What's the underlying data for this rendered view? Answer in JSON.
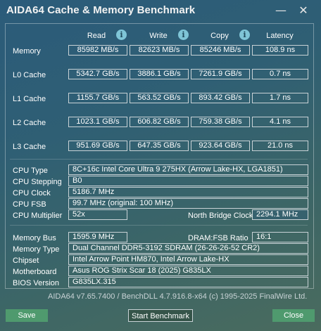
{
  "window": {
    "title": "AIDA64 Cache & Memory Benchmark",
    "minimize": "—",
    "close": "✕"
  },
  "columns": {
    "read": "Read",
    "write": "Write",
    "copy": "Copy",
    "latency": "Latency",
    "info": "i"
  },
  "rows": [
    {
      "label": "Memory",
      "read": "85982 MB/s",
      "write": "82623 MB/s",
      "copy": "85246 MB/s",
      "latency": "108.9 ns"
    },
    {
      "label": "L0 Cache",
      "read": "5342.7 GB/s",
      "write": "3886.1 GB/s",
      "copy": "7261.9 GB/s",
      "latency": "0.7 ns"
    },
    {
      "label": "L1 Cache",
      "read": "1155.7 GB/s",
      "write": "563.52 GB/s",
      "copy": "893.42 GB/s",
      "latency": "1.7 ns"
    },
    {
      "label": "L2 Cache",
      "read": "1023.1 GB/s",
      "write": "606.82 GB/s",
      "copy": "759.38 GB/s",
      "latency": "4.1 ns"
    },
    {
      "label": "L3 Cache",
      "read": "951.69 GB/s",
      "write": "647.35 GB/s",
      "copy": "923.64 GB/s",
      "latency": "21.0 ns"
    }
  ],
  "cpu": {
    "type_label": "CPU Type",
    "type": "8C+16c Intel Core Ultra 9 275HX  (Arrow Lake-HX, LGA1851)",
    "stepping_label": "CPU Stepping",
    "stepping": "B0",
    "clock_label": "CPU Clock",
    "clock": "5186.7 MHz",
    "fsb_label": "CPU FSB",
    "fsb": "99.7 MHz  (original: 100 MHz)",
    "multiplier_label": "CPU Multiplier",
    "multiplier": "52x",
    "nb_clock_label": "North Bridge Clock",
    "nb_clock": "2294.1 MHz"
  },
  "memory": {
    "bus_label": "Memory Bus",
    "bus": "1595.9 MHz",
    "ratio_label": "DRAM:FSB Ratio",
    "ratio": "16:1",
    "type_label": "Memory Type",
    "type": "Dual Channel DDR5-3192 SDRAM  (26-26-26-52 CR2)",
    "chipset_label": "Chipset",
    "chipset": "Intel Arrow Point HM870, Intel Arrow Lake-HX",
    "motherboard_label": "Motherboard",
    "motherboard": "Asus ROG Strix Scar 18 (2025) G835LX",
    "bios_label": "BIOS Version",
    "bios": "G835LX.315"
  },
  "footer": "AIDA64 v7.65.7400 / BenchDLL 4.7.916.8-x64  (c) 1995-2025 FinalWire Ltd.",
  "buttons": {
    "save": "Save",
    "start": "Start Benchmark",
    "close": "Close"
  }
}
